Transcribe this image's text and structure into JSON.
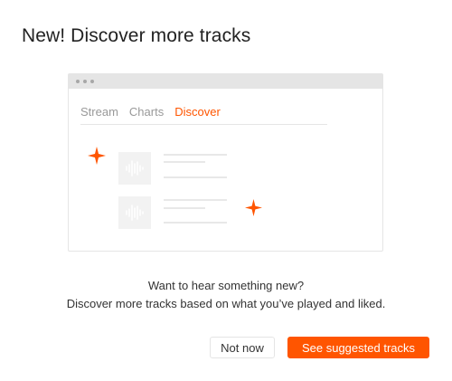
{
  "dialog": {
    "title": "New! Discover more tracks",
    "message_line1": "Want to hear something new?",
    "message_line2": "Discover more tracks based on what you’ve played and liked."
  },
  "illustration": {
    "tabs": [
      {
        "label": "Stream",
        "active": false
      },
      {
        "label": "Charts",
        "active": false
      },
      {
        "label": "Discover",
        "active": true
      }
    ]
  },
  "buttons": {
    "not_now": "Not now",
    "see_suggested": "See suggested tracks"
  },
  "colors": {
    "accent": "#ff5500",
    "placeholder": "#f2f2f2",
    "border": "#e5e5e5"
  },
  "icons": [
    "sparkle-icon",
    "waveform-icon"
  ]
}
